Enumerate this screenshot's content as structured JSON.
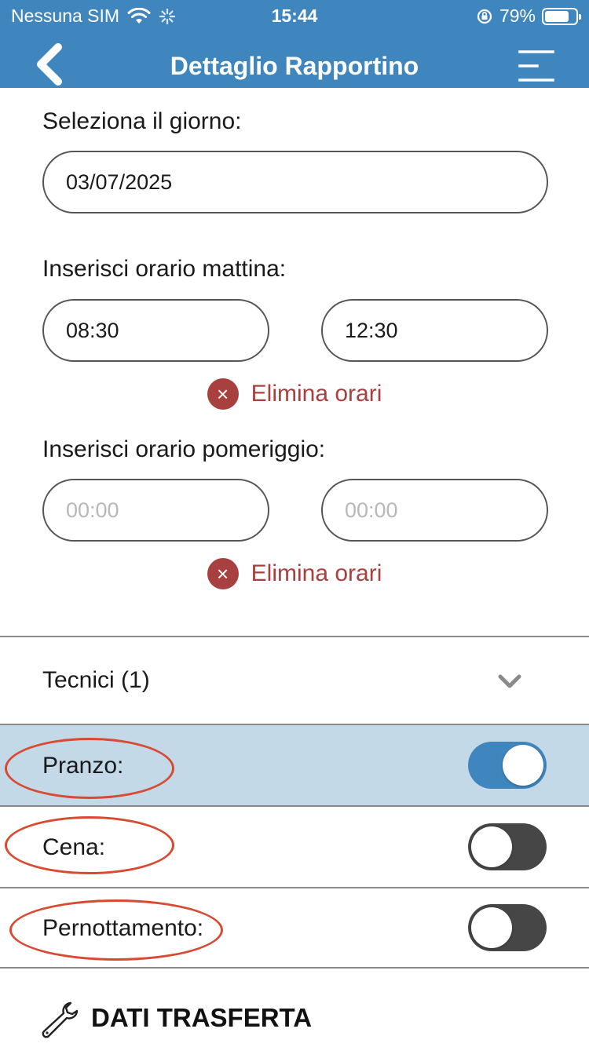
{
  "status_bar": {
    "carrier": "Nessuna SIM",
    "time": "15:44",
    "battery_percent": "79%",
    "battery_level": 0.79
  },
  "nav": {
    "title": "Dettaglio Rapportino",
    "back_icon": "chevron-left-icon",
    "menu_icon": "menu-icon"
  },
  "day": {
    "label": "Seleziona il giorno:",
    "value": "03/07/2025"
  },
  "morning": {
    "label": "Inserisci orario mattina:",
    "start": "08:30",
    "end": "12:30",
    "delete_label": "Elimina orari"
  },
  "afternoon": {
    "label": "Inserisci orario pomeriggio:",
    "start_placeholder": "00:00",
    "end_placeholder": "00:00",
    "delete_label": "Elimina orari"
  },
  "technicians": {
    "label": "Tecnici (1)"
  },
  "toggles": [
    {
      "label": "Pranzo:",
      "on": true
    },
    {
      "label": "Cena:",
      "on": false
    },
    {
      "label": "Pernottamento:",
      "on": false
    }
  ],
  "section": {
    "title": "DATI TRASFERTA",
    "icon": "wrench-icon"
  },
  "colors": {
    "primary": "#3f86bf",
    "highlight_row": "#c3d9e8",
    "danger": "#a8403f",
    "annotation": "#d94a33",
    "toggle_off": "#464646"
  }
}
